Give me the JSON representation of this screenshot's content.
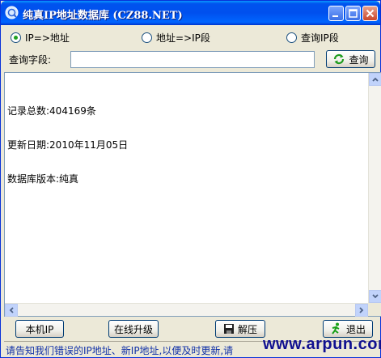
{
  "window": {
    "title": "纯真IP地址数据库 (CZ88.NET)",
    "icon": "globe-icon",
    "accent": "#0053ee"
  },
  "modes": [
    {
      "label": "IP=>地址",
      "selected": true
    },
    {
      "label": "地址=>IP段",
      "selected": false
    },
    {
      "label": "查询IP段",
      "selected": false
    }
  ],
  "query": {
    "label": "查询字段:",
    "value": "",
    "button_label": "查询"
  },
  "result": {
    "lines": [
      "记录总数:404169条",
      "更新日期:2010年11月05日",
      "数据库版本:纯真"
    ]
  },
  "buttons": {
    "local_ip": "本机IP",
    "upgrade": "在线升级",
    "extract": "解压",
    "exit": "退出"
  },
  "status": {
    "text": "请告知我们错误的IP地址、新IP地址,以便及时更新,请"
  },
  "watermark": "www.arpun.com"
}
